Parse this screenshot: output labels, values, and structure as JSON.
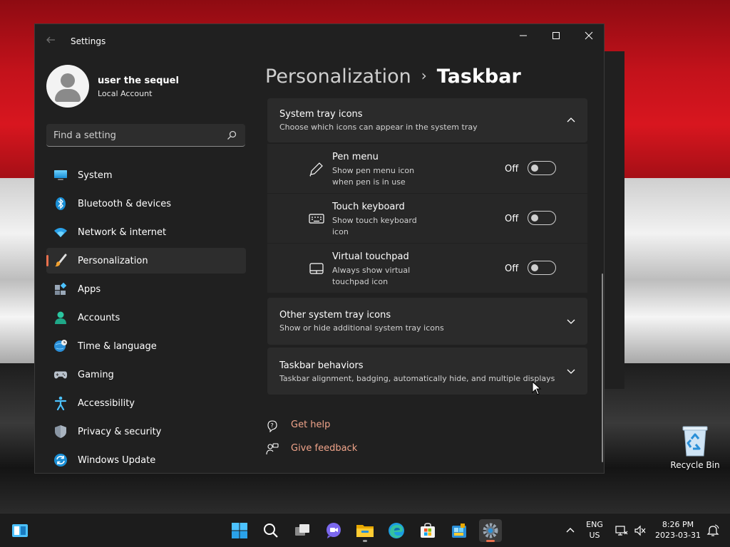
{
  "window": {
    "title": "Settings",
    "back_icon": "back-arrow-icon",
    "minimize": "—",
    "maximize": "☐",
    "close": "✕"
  },
  "profile": {
    "name": "user the sequel",
    "account_type": "Local Account"
  },
  "search": {
    "placeholder": "Find a setting"
  },
  "sidebar": {
    "items": [
      {
        "label": "System",
        "icon": "monitor-icon"
      },
      {
        "label": "Bluetooth & devices",
        "icon": "bluetooth-icon"
      },
      {
        "label": "Network & internet",
        "icon": "wifi-icon"
      },
      {
        "label": "Personalization",
        "icon": "brush-icon",
        "active": true
      },
      {
        "label": "Apps",
        "icon": "apps-icon"
      },
      {
        "label": "Accounts",
        "icon": "person-icon"
      },
      {
        "label": "Time & language",
        "icon": "globe-clock-icon"
      },
      {
        "label": "Gaming",
        "icon": "gamepad-icon"
      },
      {
        "label": "Accessibility",
        "icon": "accessibility-icon"
      },
      {
        "label": "Privacy & security",
        "icon": "shield-icon"
      },
      {
        "label": "Windows Update",
        "icon": "update-icon"
      }
    ]
  },
  "breadcrumb": {
    "parent": "Personalization",
    "separator": "›",
    "current": "Taskbar"
  },
  "sections": {
    "system_tray": {
      "title": "System tray icons",
      "subtitle": "Choose which icons can appear in the system tray",
      "rows": [
        {
          "title": "Pen menu",
          "desc": "Show pen menu icon when pen is in use",
          "state": "Off",
          "icon": "pen-icon"
        },
        {
          "title": "Touch keyboard",
          "desc": "Show touch keyboard icon",
          "state": "Off",
          "icon": "keyboard-icon"
        },
        {
          "title": "Virtual touchpad",
          "desc": "Always show virtual touchpad icon",
          "state": "Off",
          "icon": "touchpad-icon"
        }
      ]
    },
    "other_tray": {
      "title": "Other system tray icons",
      "subtitle": "Show or hide additional system tray icons"
    },
    "behaviors": {
      "title": "Taskbar behaviors",
      "subtitle": "Taskbar alignment, badging, automatically hide, and multiple displays"
    }
  },
  "links": {
    "help": "Get help",
    "feedback": "Give feedback"
  },
  "desktop": {
    "recycle_bin": "Recycle Bin"
  },
  "taskbar": {
    "lang_top": "ENG",
    "lang_bottom": "US",
    "time": "8:26 PM",
    "date": "2023-03-31"
  },
  "colors": {
    "accent": "#e8704d",
    "window_bg": "#202020",
    "card_bg": "#2b2b2b",
    "link": "#f0a48a"
  }
}
